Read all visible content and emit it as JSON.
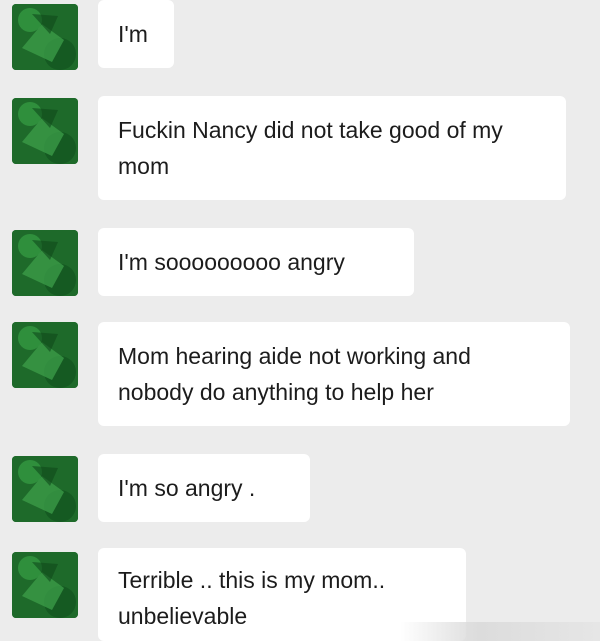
{
  "messages": [
    {
      "avatar_icon": "contact-avatar-icon",
      "text": "I'm"
    },
    {
      "avatar_icon": "contact-avatar-icon",
      "text": "Fuckin Nancy did not take good of my mom"
    },
    {
      "avatar_icon": "contact-avatar-icon",
      "text": "I'm sooooooooo angry"
    },
    {
      "avatar_icon": "contact-avatar-icon",
      "text": "Mom hearing aide not working and nobody do anything to help her"
    },
    {
      "avatar_icon": "contact-avatar-icon",
      "text": "I'm so angry ."
    },
    {
      "avatar_icon": "contact-avatar-icon",
      "text": "Terrible .. this is my mom.. unbelievable"
    }
  ],
  "colors": {
    "background": "#ececec",
    "bubble": "#ffffff",
    "text": "#1c1c1c",
    "avatar": "#1f6b2a"
  }
}
